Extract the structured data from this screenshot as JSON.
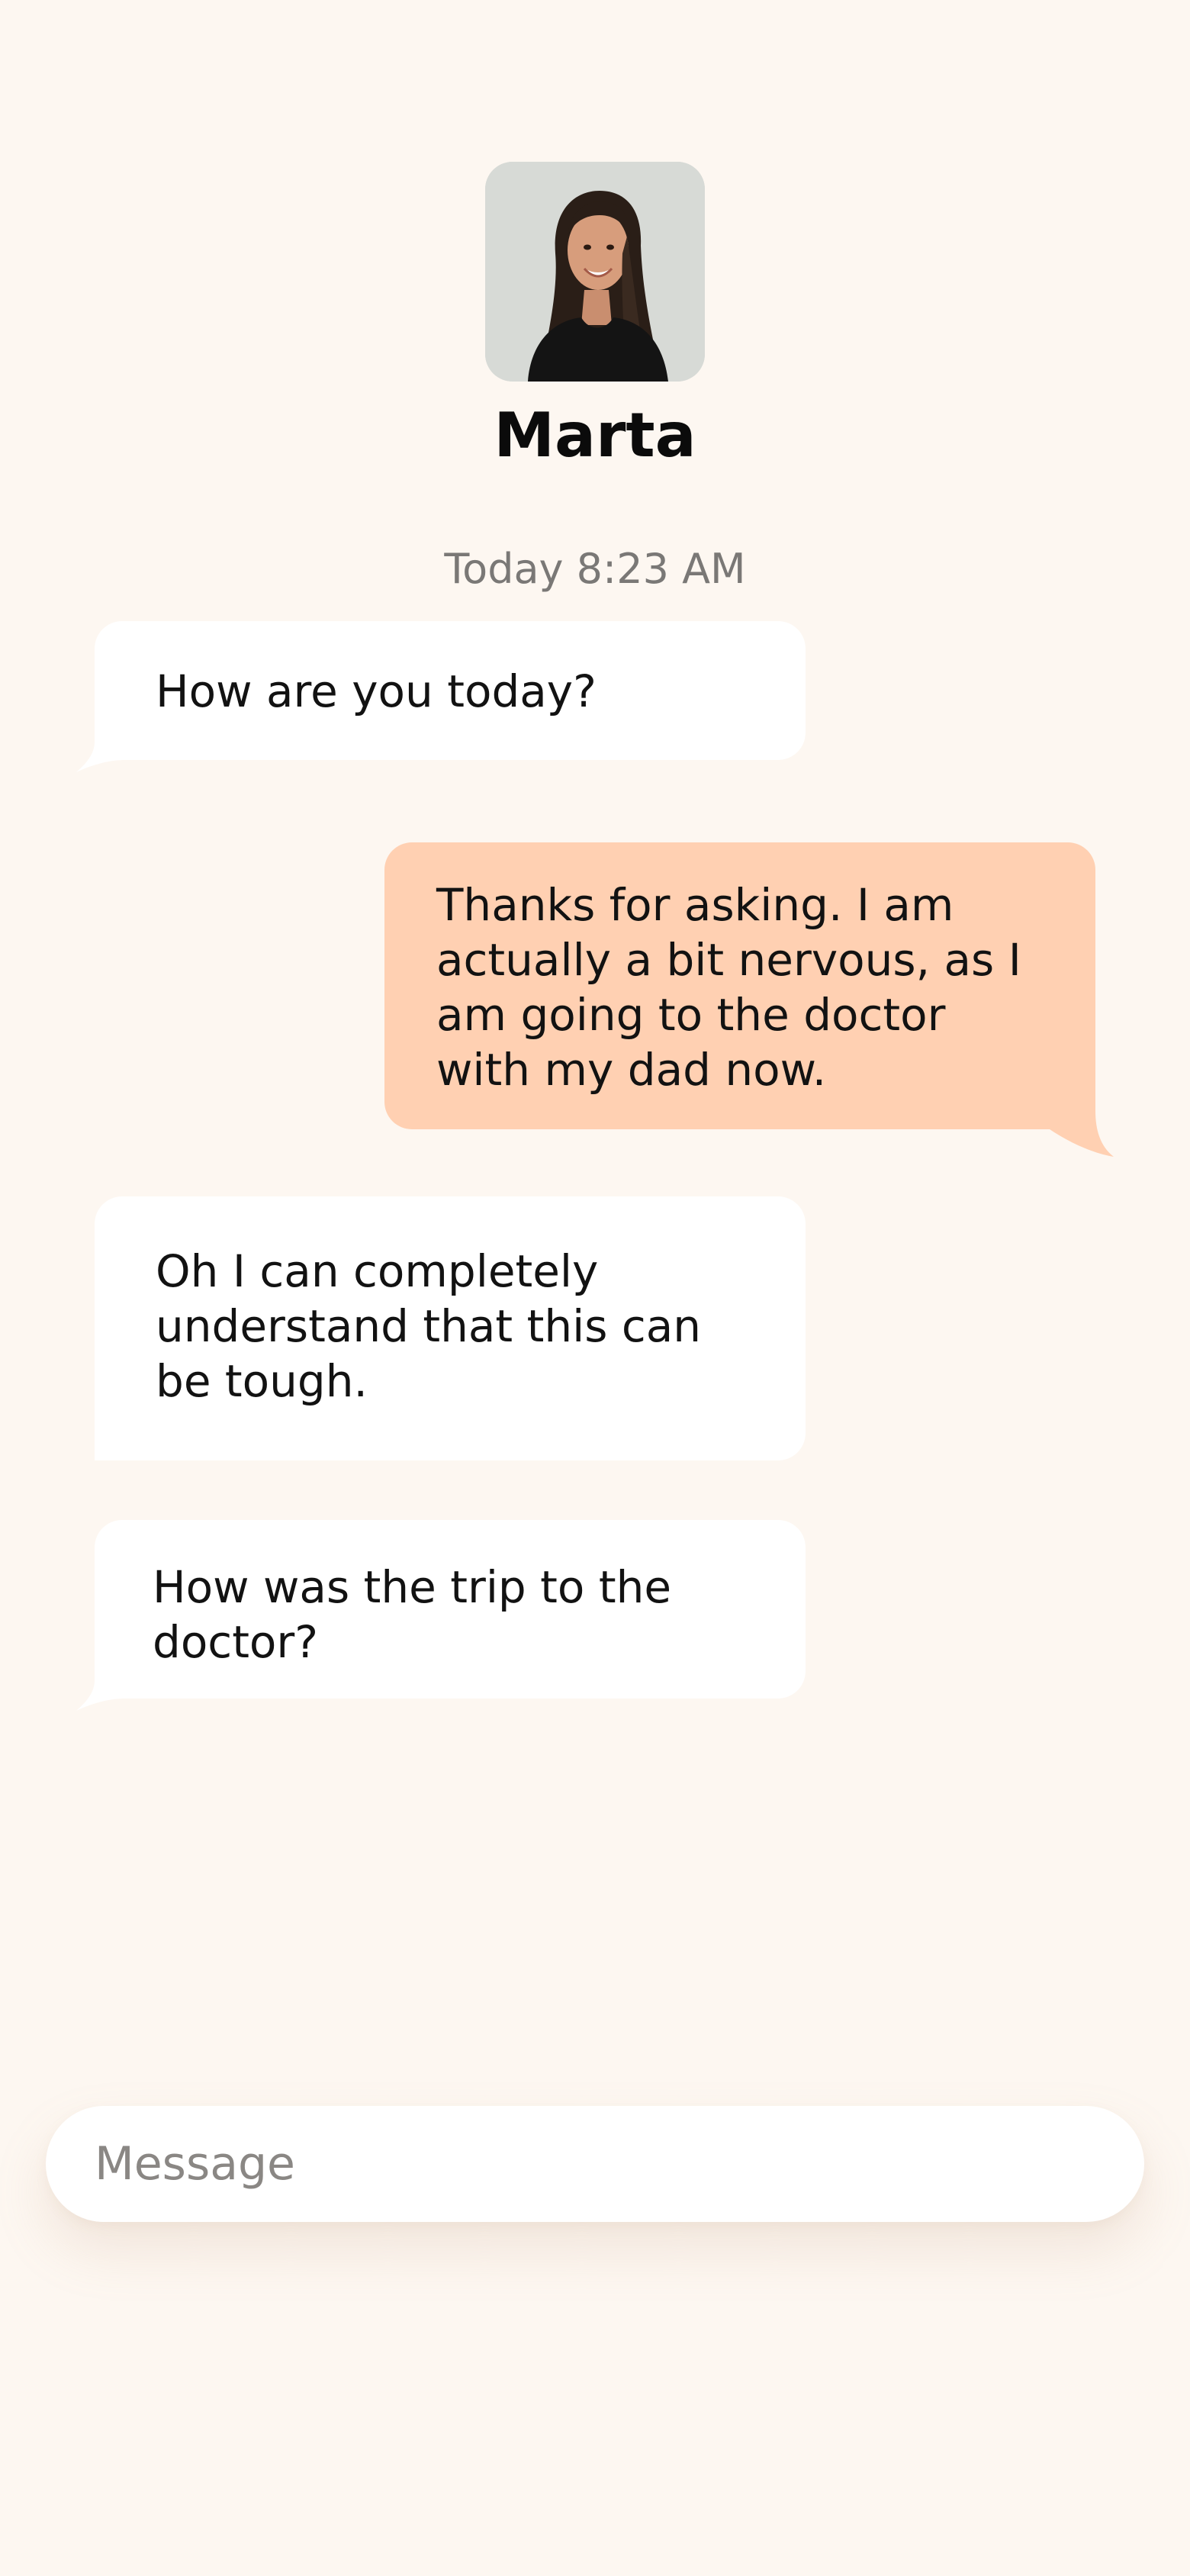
{
  "contact": {
    "name": "Marta",
    "avatar_icon": "profile-photo"
  },
  "conversation": {
    "timestamp": "Today 8:23 AM",
    "messages": [
      {
        "direction": "incoming",
        "text": "How are you today?"
      },
      {
        "direction": "outgoing",
        "text": "Thanks for asking. I am actually a bit nervous, as I am going to the doctor with my dad now."
      },
      {
        "direction": "incoming",
        "text": "Oh I can completely understand that this can be tough."
      },
      {
        "direction": "incoming",
        "text": "How was the trip to the doctor?"
      }
    ]
  },
  "composer": {
    "placeholder": "Message",
    "value": ""
  },
  "colors": {
    "background": "#fdf7f1",
    "incoming_bubble": "#ffffff",
    "outgoing_bubble": "#ffd0b2",
    "timestamp_text": "#7a7876",
    "placeholder_text": "#8a8784"
  }
}
